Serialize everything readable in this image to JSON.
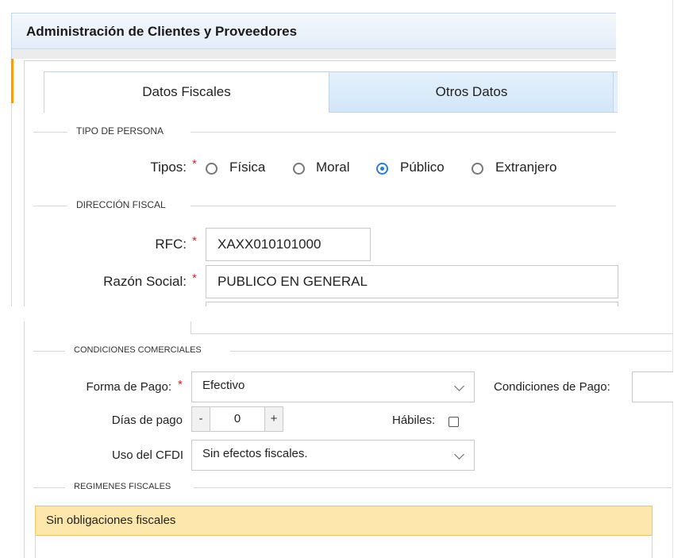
{
  "window": {
    "title": "Administración de Clientes y Proveedores"
  },
  "tabs": [
    {
      "label": "Datos Fiscales",
      "active": true
    },
    {
      "label": "Otros Datos",
      "active": false
    }
  ],
  "tipo_persona": {
    "legend": "TIPO DE PERSONA",
    "label": "Tipos:",
    "required_mark": "*",
    "options": [
      {
        "label": "Física",
        "checked": false
      },
      {
        "label": "Moral",
        "checked": false
      },
      {
        "label": "Público",
        "checked": true
      },
      {
        "label": "Extranjero",
        "checked": false
      }
    ]
  },
  "direccion_fiscal": {
    "legend": "DIRECCIÓN FISCAL",
    "rfc": {
      "label": "RFC:",
      "required_mark": "*",
      "value": "XAXX010101000"
    },
    "razon_social": {
      "label": "Razón Social:",
      "required_mark": "*",
      "value": "PUBLICO EN GENERAL"
    }
  },
  "condiciones_comerciales": {
    "legend": "CONDICIONES COMERCIALES",
    "forma_pago": {
      "label": "Forma de Pago:",
      "required_mark": "*",
      "value": "Efectivo"
    },
    "condiciones_pago": {
      "label": "Condiciones de Pago:",
      "value": ""
    },
    "dias_pago": {
      "label": "Días de pago",
      "minus": "-",
      "value": "0",
      "plus": "+"
    },
    "habiles": {
      "label": "Hábiles:",
      "checked": false
    },
    "uso_cfdi": {
      "label": "Uso del CFDI",
      "value": "Sin efectos fiscales."
    }
  },
  "regimenes_fiscales": {
    "legend": "REGIMENES FISCALES",
    "selected_row": "Sin obligaciones fiscales"
  },
  "colors": {
    "accent": "#2a7fd4",
    "required": "#e02020",
    "highlight_row": "#fde7ac",
    "tab_inactive": "#d2e6f8"
  }
}
